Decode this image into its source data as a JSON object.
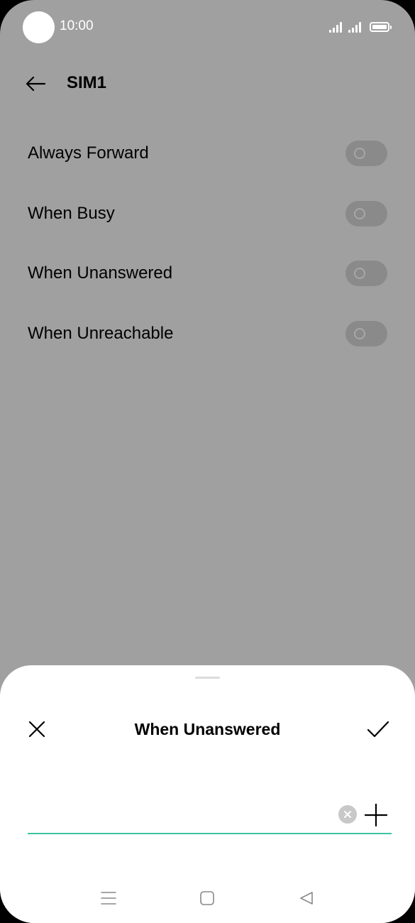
{
  "status_bar": {
    "time": "10:00"
  },
  "header": {
    "title": "SIM1",
    "back_icon": "arrow-left-icon"
  },
  "forwarding_options": [
    {
      "label": "Always Forward",
      "enabled": false
    },
    {
      "label": "When Busy",
      "enabled": false
    },
    {
      "label": "When Unanswered",
      "enabled": false
    },
    {
      "label": "When Unreachable",
      "enabled": false
    }
  ],
  "sheet": {
    "title": "When Unanswered",
    "number_value": "",
    "close_icon": "close-icon",
    "confirm_icon": "check-icon",
    "clear_icon": "clear-icon",
    "add_icon": "plus-icon"
  },
  "nav_bar": {
    "items": [
      "menu-icon",
      "home-icon",
      "back-triangle-icon"
    ]
  },
  "colors": {
    "dim_background": "#a0a0a0",
    "sheet_background": "#ffffff",
    "accent_underline": "#3fc4a2",
    "toggle_off": "#8a8a8a"
  }
}
